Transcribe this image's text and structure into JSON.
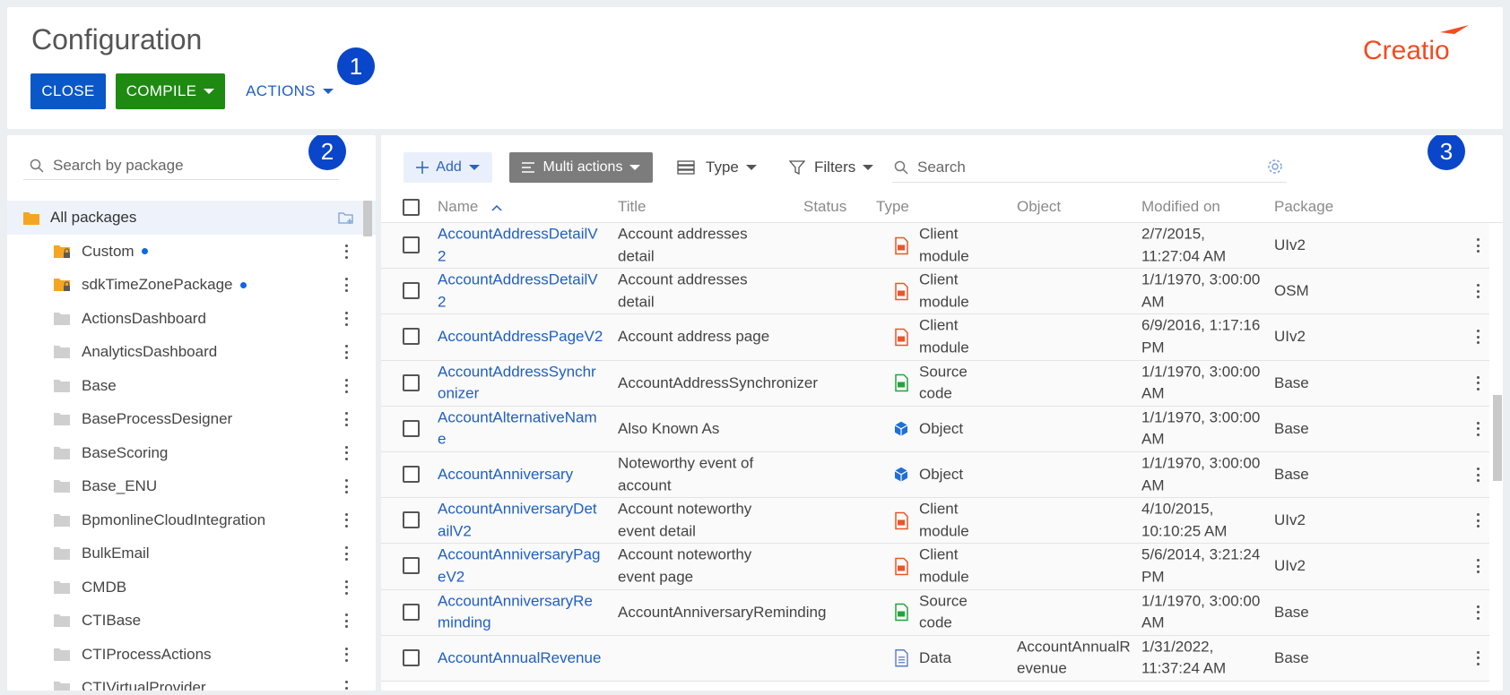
{
  "header": {
    "title": "Configuration",
    "close_label": "CLOSE",
    "compile_label": "COMPILE",
    "actions_label": "ACTIONS",
    "logo_text": "Creatio",
    "badge_1": "1"
  },
  "packages": {
    "badge": "2",
    "search_placeholder": "Search by package",
    "all_label": "All packages",
    "items": [
      {
        "label": "Custom",
        "locked": true,
        "dot": true
      },
      {
        "label": "sdkTimeZonePackage",
        "locked": true,
        "dot": true
      },
      {
        "label": "ActionsDashboard"
      },
      {
        "label": "AnalyticsDashboard"
      },
      {
        "label": "Base"
      },
      {
        "label": "BaseProcessDesigner"
      },
      {
        "label": "BaseScoring"
      },
      {
        "label": "Base_ENU"
      },
      {
        "label": "BpmonlineCloudIntegration"
      },
      {
        "label": "BulkEmail"
      },
      {
        "label": "CMDB"
      },
      {
        "label": "CTIBase"
      },
      {
        "label": "CTIProcessActions"
      },
      {
        "label": "CTIVirtualProvider"
      }
    ]
  },
  "grid": {
    "badge": "3",
    "add_label": "Add",
    "multi_label": "Multi actions",
    "type_label": "Type",
    "filters_label": "Filters",
    "search_placeholder": "Search",
    "columns": {
      "name": "Name",
      "title": "Title",
      "status": "Status",
      "type": "Type",
      "object": "Object",
      "modified": "Modified on",
      "package": "Package"
    },
    "rows": [
      {
        "name": "AccountAddressDetailV2",
        "title": "Account addresses detail",
        "type": "Client module",
        "type_icon": "client-module-icon",
        "object": "",
        "modified": "2/7/2015, 11:27:04 AM",
        "package": "UIv2"
      },
      {
        "name": "AccountAddressDetailV2",
        "title": "Account addresses detail",
        "type": "Client module",
        "type_icon": "client-module-icon",
        "object": "",
        "modified": "1/1/1970, 3:00:00 AM",
        "package": "OSM"
      },
      {
        "name": "AccountAddressPageV2",
        "title": "Account address page",
        "type": "Client module",
        "type_icon": "client-module-icon",
        "object": "",
        "modified": "6/9/2016, 1:17:16 PM",
        "package": "UIv2"
      },
      {
        "name": "AccountAddressSynchronizer",
        "title": "AccountAddressSynchronizer",
        "type": "Source code",
        "type_icon": "source-code-icon",
        "object": "",
        "modified": "1/1/1970, 3:00:00 AM",
        "package": "Base"
      },
      {
        "name": "AccountAlternativeName",
        "title": "Also Known As",
        "type": "Object",
        "type_icon": "object-icon",
        "object": "",
        "modified": "1/1/1970, 3:00:00 AM",
        "package": "Base"
      },
      {
        "name": "AccountAnniversary",
        "title": "Noteworthy event of account",
        "type": "Object",
        "type_icon": "object-icon",
        "object": "",
        "modified": "1/1/1970, 3:00:00 AM",
        "package": "Base"
      },
      {
        "name": "AccountAnniversaryDetailV2",
        "title": "Account noteworthy event detail",
        "type": "Client module",
        "type_icon": "client-module-icon",
        "object": "",
        "modified": "4/10/2015, 10:10:25 AM",
        "package": "UIv2"
      },
      {
        "name": "AccountAnniversaryPageV2",
        "title": "Account noteworthy event page",
        "type": "Client module",
        "type_icon": "client-module-icon",
        "object": "",
        "modified": "5/6/2014, 3:21:24 PM",
        "package": "UIv2"
      },
      {
        "name": "AccountAnniversaryReminding",
        "title": "AccountAnniversaryReminding",
        "type": "Source code",
        "type_icon": "source-code-icon",
        "object": "",
        "modified": "1/1/1970, 3:00:00 AM",
        "package": "Base"
      },
      {
        "name": "AccountAnnualRevenue",
        "title": "",
        "type": "Data",
        "type_icon": "data-icon",
        "object": "AccountAnnualRevenue",
        "modified": "1/31/2022, 11:37:24 AM",
        "package": "Base"
      }
    ]
  },
  "colors": {
    "primary": "#0a58c8",
    "compile": "#1e8a12",
    "link": "#1f5fc4",
    "badge": "#0a46c9",
    "logo": "#f04c23"
  }
}
